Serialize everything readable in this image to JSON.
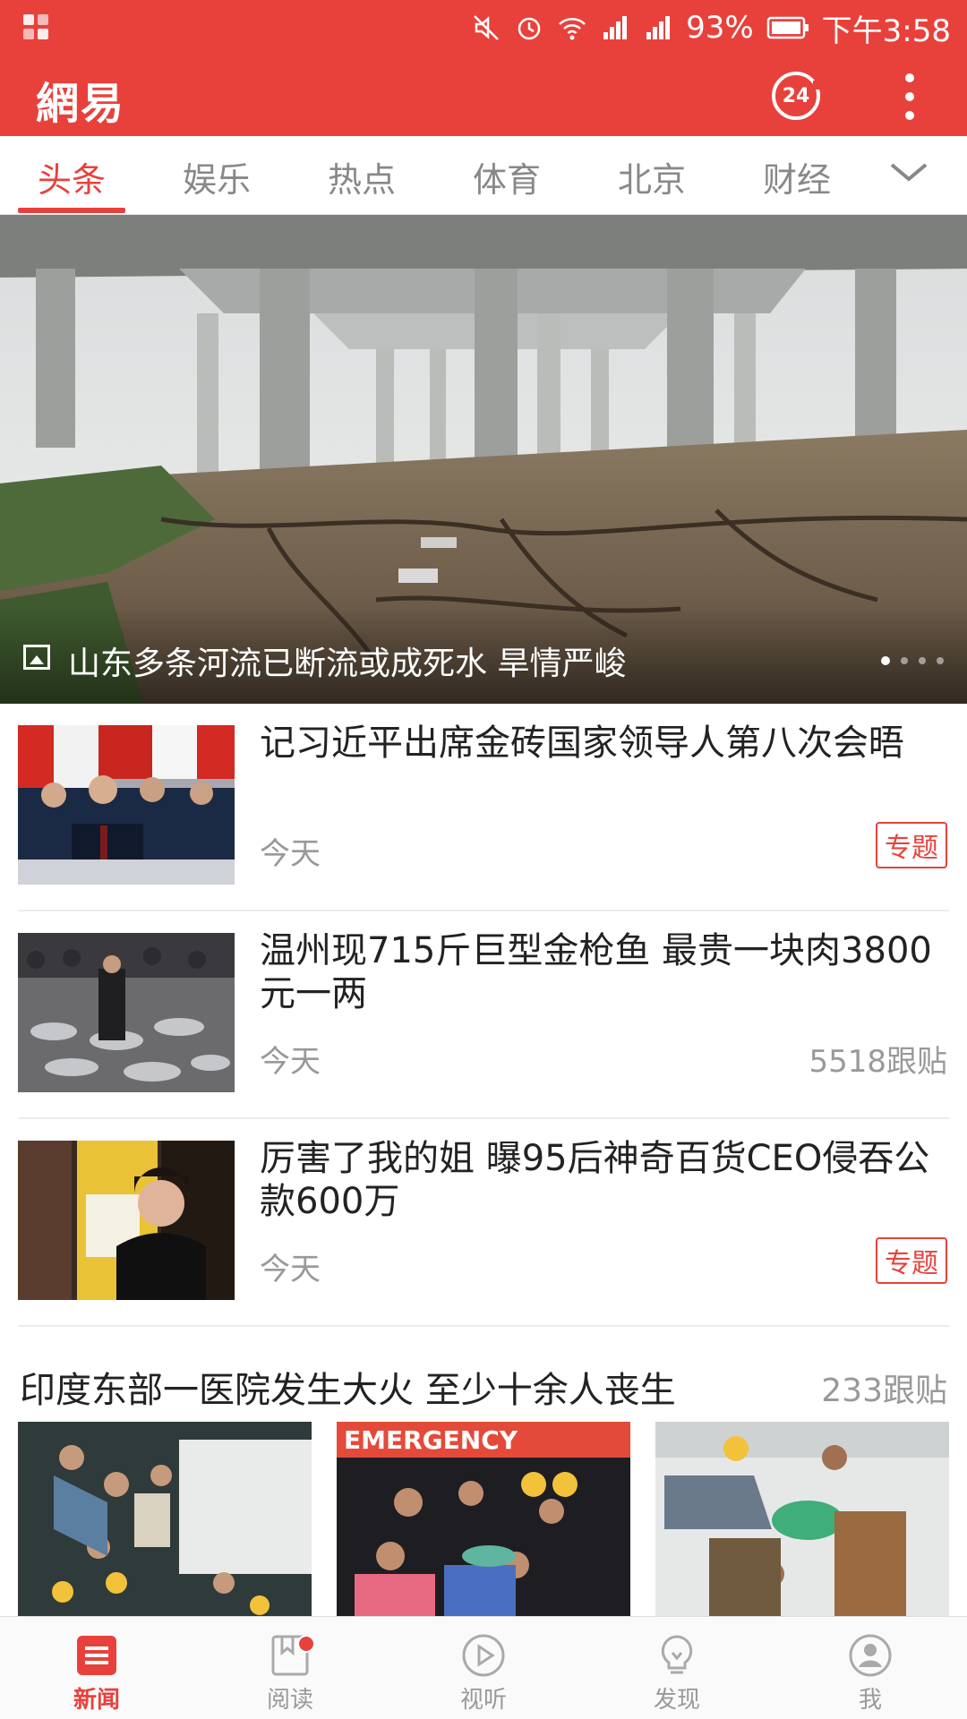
{
  "status_bar": {
    "battery": "93%",
    "time": "下午3:58"
  },
  "app": {
    "logo": "網易",
    "history_badge": "24"
  },
  "tabs": [
    {
      "label": "头条",
      "active": true
    },
    {
      "label": "娱乐"
    },
    {
      "label": "热点"
    },
    {
      "label": "体育"
    },
    {
      "label": "北京"
    },
    {
      "label": "财经"
    }
  ],
  "hero": {
    "title": "山东多条河流已断流或成死水 旱情严峻",
    "slides": 4,
    "active_slide": 1
  },
  "news": [
    {
      "title": "记习近平出席金砖国家领导人第八次会晤",
      "time": "今天",
      "tag": "专题"
    },
    {
      "title": "温州现715斤巨型金枪鱼 最贵一块肉3800元一两",
      "time": "今天",
      "comments": "5518跟贴"
    },
    {
      "title": "厉害了我的姐 曝95后神奇百货CEO侵吞公款600万",
      "time": "今天",
      "tag": "专题"
    }
  ],
  "gallery_item": {
    "title": "印度东部一医院发生大火 至少十余人丧生",
    "comments": "233跟贴"
  },
  "bottom_nav": [
    {
      "label": "新闻",
      "icon": "news-icon",
      "active": true
    },
    {
      "label": "阅读",
      "icon": "reading-icon"
    },
    {
      "label": "视听",
      "icon": "play-icon"
    },
    {
      "label": "发现",
      "icon": "bulb-icon"
    },
    {
      "label": "我",
      "icon": "user-icon"
    }
  ],
  "colors": {
    "brand": "#e8413c"
  }
}
